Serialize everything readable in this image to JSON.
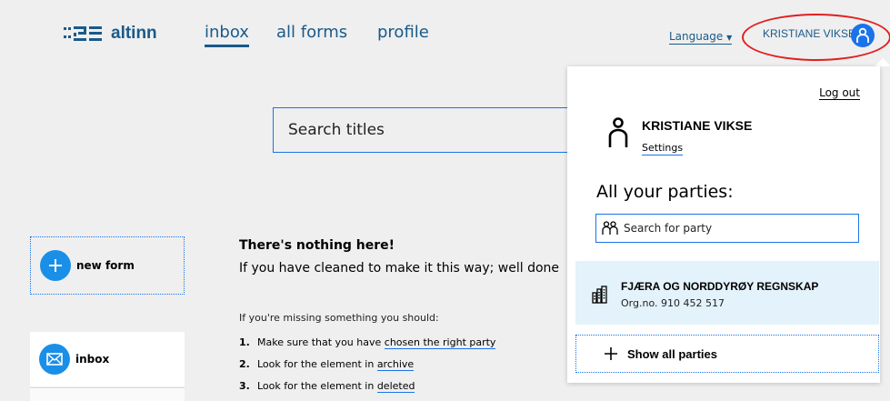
{
  "header": {
    "brand": "altinn",
    "nav": [
      {
        "label": "inbox"
      },
      {
        "label": "all forms"
      },
      {
        "label": "profile"
      }
    ],
    "language_label": "Language",
    "user_name": "KRISTIANE VIKSE"
  },
  "search": {
    "placeholder": "Search titles"
  },
  "sidebar": {
    "new_form": "new form",
    "inbox": "inbox"
  },
  "empty_state": {
    "title": "There's nothing here!",
    "subtitle": "If you have cleaned to make it this way; well done",
    "missing": "If you're missing something you should:",
    "tips": [
      {
        "num": "1.",
        "text": "Make sure that you have ",
        "link": "chosen the right party"
      },
      {
        "num": "2.",
        "text": "Look for the element in ",
        "link": "archive"
      },
      {
        "num": "3.",
        "text": "Look for the element in ",
        "link": "deleted"
      }
    ]
  },
  "profile_menu": {
    "logout": "Log out",
    "name": "KRISTIANE VIKSE",
    "settings": "Settings",
    "parties_title": "All your parties:",
    "party_search_placeholder": "Search for party",
    "party": {
      "name": "FJÆRA OG NORDDYRØY REGNSKAP",
      "org": "Org.no. 910 452 517"
    },
    "show_all": "Show all parties"
  },
  "colors": {
    "brand": "#1a5a8a",
    "accent": "#1a73e8",
    "highlight": "#e02020",
    "party_bg": "#e3f2fb"
  }
}
